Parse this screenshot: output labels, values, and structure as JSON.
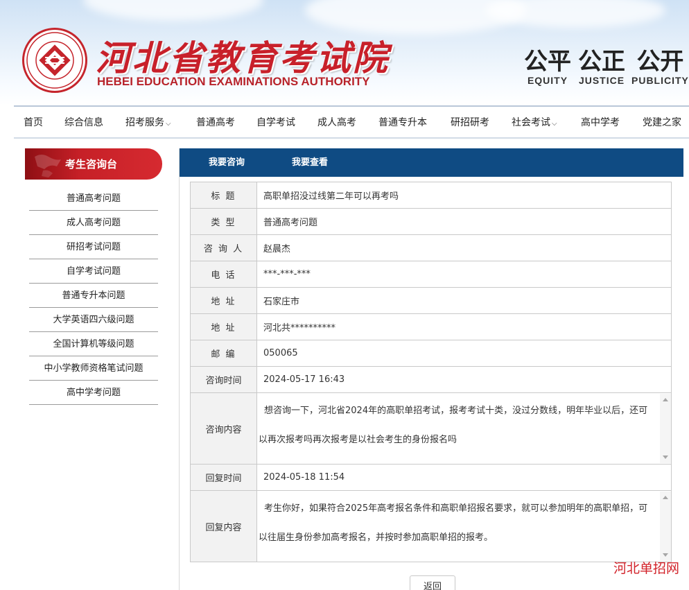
{
  "header": {
    "title_cn": "河北省教育考试院",
    "title_en": "HEBEI EDUCATION EXAMINATIONS AUTHORITY",
    "seal_text": "河北省教育考试院 HEBEI EDUCATION EXAMINATIONS AUTHORITY",
    "mottos": [
      {
        "cn": "公平",
        "en": "EQUITY"
      },
      {
        "cn": "公正",
        "en": "JUSTICE"
      },
      {
        "cn": "公开",
        "en": "PUBLICITY"
      }
    ],
    "brand_color": "#c8202a"
  },
  "nav": {
    "items": [
      {
        "label": "首页",
        "dropdown": false
      },
      {
        "label": "综合信息",
        "dropdown": false
      },
      {
        "label": "招考服务",
        "dropdown": true
      },
      {
        "label": "普通高考",
        "dropdown": false
      },
      {
        "label": "自学考试",
        "dropdown": false
      },
      {
        "label": "成人高考",
        "dropdown": false
      },
      {
        "label": "普通专升本",
        "dropdown": false
      },
      {
        "label": "研招研考",
        "dropdown": false
      },
      {
        "label": "社会考试",
        "dropdown": true
      },
      {
        "label": "高中学考",
        "dropdown": false
      },
      {
        "label": "党建之家",
        "dropdown": false
      }
    ],
    "chevron": "⌵"
  },
  "sidebar": {
    "title": "考生咨询台",
    "items": [
      "普通高考问题",
      "成人高考问题",
      "研招考试问题",
      "自学考试问题",
      "普通专升本问题",
      "大学英语四六级问题",
      "全国计算机等级问题",
      "中小学教师资格笔试问题",
      "高中学考问题"
    ]
  },
  "tabs": {
    "ask": "我要咨询",
    "view": "我要查看",
    "bar_color": "#0f4b83"
  },
  "record": {
    "title_label": "标 题",
    "title_value": "高职单招没过线第二年可以再考吗",
    "type_label": "类 型",
    "type_value": "普通高考问题",
    "asker_label": "咨 询 人",
    "asker_value": "赵晨杰",
    "phone_label": "电 话",
    "phone_value": "***-***-***",
    "address1_label": "地 址",
    "address1_value": "石家庄市",
    "address2_label": "地 址",
    "address2_value": "河北共**********",
    "postcode_label": "邮 编",
    "postcode_value": "050065",
    "ask_time_label": "咨询时间",
    "ask_time_value": "2024-05-17 16:43",
    "ask_content_label": "咨询内容",
    "ask_content_value": "想咨询一下，河北省2024年的高职单招考试，报考考试十类，没过分数线，明年毕业以后，还可以再次报考吗再次报考是以社会考生的身份报名吗",
    "reply_time_label": "回复时间",
    "reply_time_value": "2024-05-18 11:54",
    "reply_content_label": "回复内容",
    "reply_content_value": "考生你好，如果符合2025年高考报名条件和高职单招报名要求，就可以参加明年的高职单招，可以往届生身份参加高考报名，并按时参加高职单招的报考。"
  },
  "back_button": "返回",
  "watermark": "河北单招网"
}
